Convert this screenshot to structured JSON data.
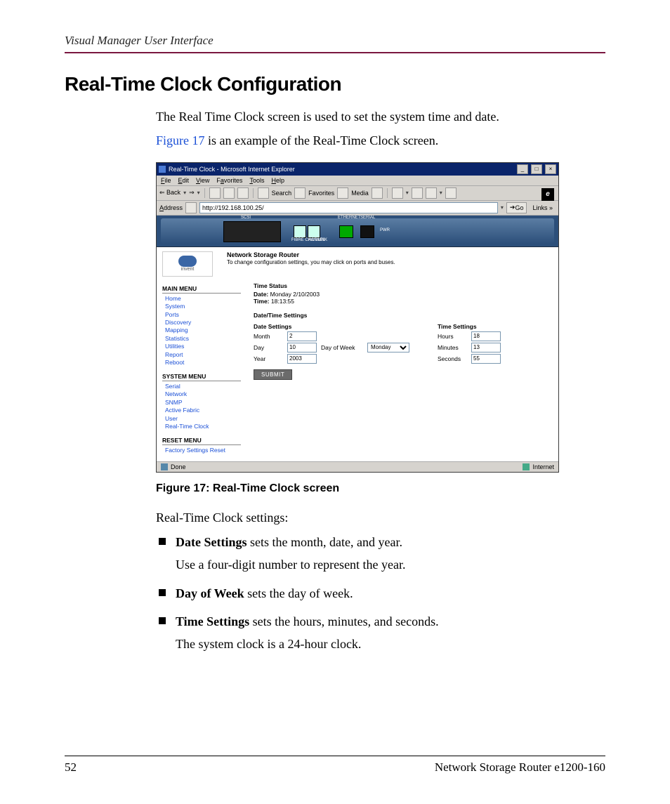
{
  "header": {
    "running_head": "Visual Manager User Interface"
  },
  "title": "Real-Time Clock Configuration",
  "intro": {
    "p1": "The Real Time Clock screen is used to set the system time and date.",
    "p2_link": "Figure 17",
    "p2_rest": " is an example of the Real-Time Clock screen."
  },
  "browser": {
    "window_title": "Real-Time Clock - Microsoft Internet Explorer",
    "menus": {
      "file": "File",
      "edit": "Edit",
      "view": "View",
      "favorites": "Favorites",
      "tools": "Tools",
      "help": "Help"
    },
    "toolbar": {
      "back": "Back",
      "search": "Search",
      "favorites": "Favorites",
      "media": "Media"
    },
    "address_label": "Address",
    "address_value": "http://192.168.100.25/",
    "go": "Go",
    "links": "Links »",
    "status_left": "Done",
    "status_right": "Internet",
    "win_buttons": {
      "min": "_",
      "max": "□",
      "close": "×"
    }
  },
  "device": {
    "brand_sub": "invent",
    "header_title": "Network Storage Router",
    "header_sub": "To change configuration settings, you may click on ports and buses.",
    "labels": {
      "scsi": "SCSI",
      "fibre": "FIBRE CHANNEL",
      "act": "ACT/LINK",
      "ethernet": "ETHERNET",
      "serial": "SERIAL",
      "pwr": "PWR"
    }
  },
  "sidebar": {
    "main_h": "MAIN MENU",
    "main": [
      "Home",
      "System",
      "Ports",
      "Discovery",
      "Mapping",
      "Statistics",
      "Utilities",
      "Report",
      "Reboot"
    ],
    "sys_h": "SYSTEM MENU",
    "sys": [
      "Serial",
      "Network",
      "SNMP",
      "Active Fabric",
      "User",
      "Real-Time Clock"
    ],
    "reset_h": "RESET MENU",
    "reset": [
      "Factory Settings Reset"
    ]
  },
  "panel": {
    "time_status_h": "Time Status",
    "date_label": "Date:",
    "date_value": "Monday 2/10/2003",
    "time_label": "Time:",
    "time_value": "18:13:55",
    "dt_h": "Date/Time Settings",
    "date_settings_h": "Date Settings",
    "time_settings_h": "Time Settings",
    "month_l": "Month",
    "month_v": "2",
    "day_l": "Day",
    "day_v": "10",
    "dow_l": "Day of Week",
    "dow_v": "Monday",
    "year_l": "Year",
    "year_v": "2003",
    "hours_l": "Hours",
    "hours_v": "18",
    "minutes_l": "Minutes",
    "minutes_v": "13",
    "seconds_l": "Seconds",
    "seconds_v": "55",
    "submit": "SUBMIT"
  },
  "caption": "Figure 17:  Real-Time Clock screen",
  "after": {
    "lead": "Real-Time Clock settings:",
    "b1_strong": "Date Settings",
    "b1_rest": " sets the month, date, and year.",
    "b1_sub": "Use a four-digit number to represent the year.",
    "b2_strong": "Day of Week",
    "b2_rest": " sets the day of week.",
    "b3_strong": "Time Settings",
    "b3_rest": " sets the hours, minutes, and seconds.",
    "b3_sub": "The system clock is a 24-hour clock."
  },
  "footer": {
    "page": "52",
    "doc": "Network Storage Router e1200-160"
  }
}
